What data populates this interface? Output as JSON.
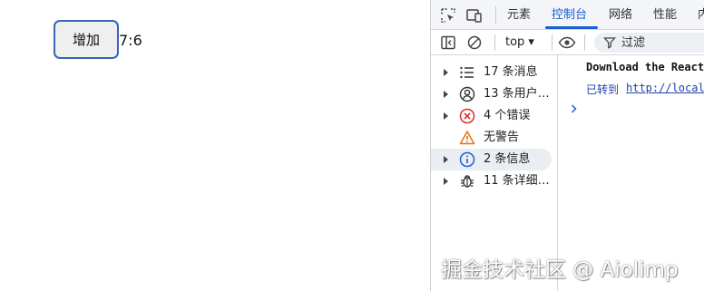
{
  "page": {
    "add_button_label": "增加",
    "counter_text": "7:6"
  },
  "devtools": {
    "tabs": [
      {
        "label": "元素",
        "active": false
      },
      {
        "label": "控制台",
        "active": true
      },
      {
        "label": "网络",
        "active": false
      },
      {
        "label": "性能",
        "active": false
      },
      {
        "label": "内",
        "active": false
      }
    ],
    "toolbar": {
      "context_label": "top ▾",
      "filter_placeholder": "过滤"
    },
    "sidebar": {
      "items": [
        {
          "label": "17 条消息",
          "icon": "list-icon"
        },
        {
          "label": "13 条用户…",
          "icon": "user-icon"
        },
        {
          "label": "4 个错误",
          "icon": "error-icon"
        },
        {
          "label": "无警告",
          "icon": "warning-icon"
        },
        {
          "label": "2 条信息",
          "icon": "info-icon"
        },
        {
          "label": "11 条详细…",
          "icon": "bug-icon"
        }
      ]
    },
    "console": {
      "message_1": "Download the React",
      "message_2_prefix": "已转到",
      "message_2_link": "http://local"
    }
  },
  "watermark": "掘金技术社区 @ Aiolimp",
  "colors": {
    "accent": "#1a5fd6",
    "error": "#d93025",
    "warning": "#e8710a",
    "button_border": "#3a63b8"
  }
}
